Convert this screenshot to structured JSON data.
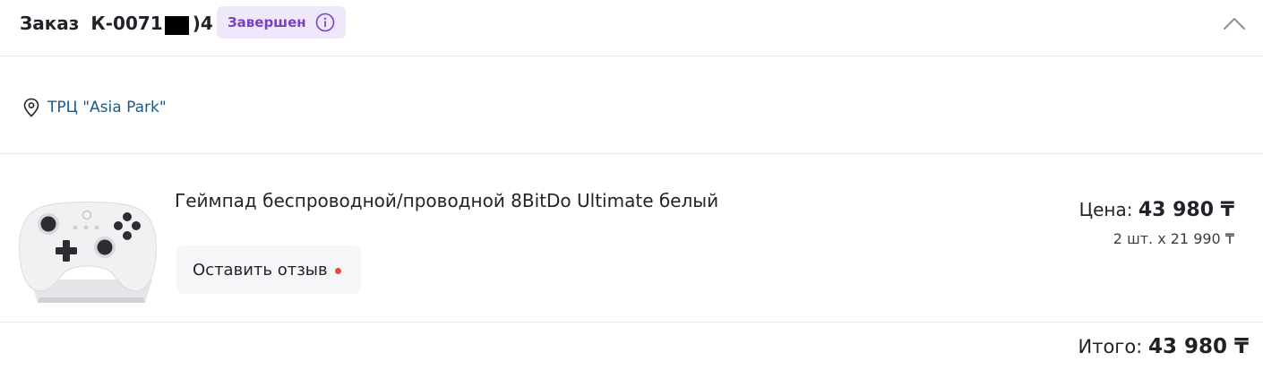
{
  "order": {
    "title_prefix": "Заказ",
    "number_start": "К-0071",
    "number_end": ")4",
    "status": "Завершен",
    "status_color": "#7b3fc4",
    "status_bg": "#efe8fb",
    "status_icon": "info-circle-icon",
    "collapse_icon": "chevron-up-icon"
  },
  "pickup": {
    "icon": "location-pin-icon",
    "label": "ТРЦ \"Asia Park\""
  },
  "item": {
    "name": "Геймпад беспроводной/проводной 8BitDo Ultimate белый",
    "image_alt": "white gamepad with charging stand",
    "review_button": "Оставить отзыв",
    "price_label": "Цена:",
    "price_value": "43 980 ₸",
    "quantity_text": "2 шт. x 21 990 ₸"
  },
  "total": {
    "label": "Итого:",
    "value": "43 980 ₸"
  },
  "colors": {
    "link": "#1a5b8a",
    "review_dot": "#e8473f",
    "divider": "#e6e8eb"
  }
}
